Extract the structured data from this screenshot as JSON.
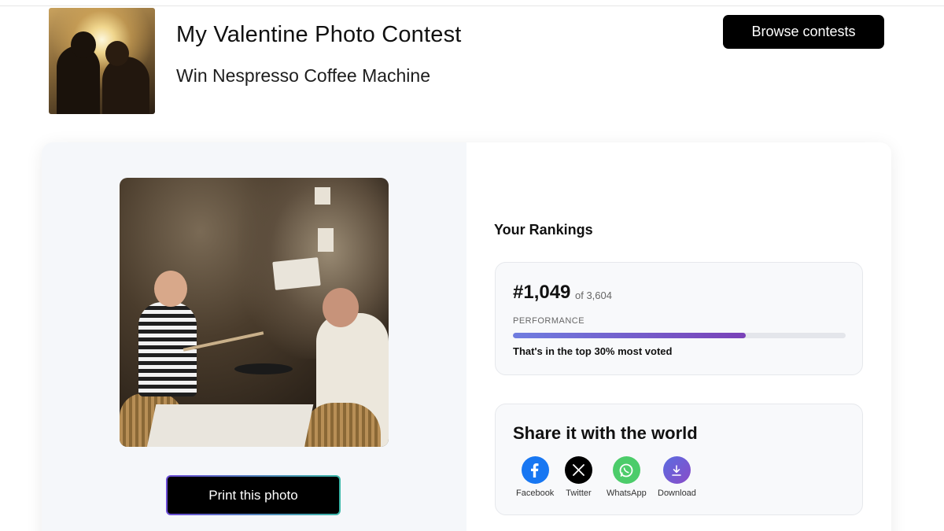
{
  "header": {
    "title": "My Valentine Photo Contest",
    "subtitle": "Win Nespresso Coffee Machine",
    "browse_label": "Browse contests"
  },
  "entry": {
    "print_label": "Print this photo"
  },
  "rankings": {
    "heading": "Your Rankings",
    "rank": "#1,049",
    "total": "of 3,604",
    "performance_label": "PERFORMANCE",
    "performance_fraction": 0.7,
    "note": "That's in the top 30% most voted"
  },
  "share": {
    "heading": "Share it with the world",
    "items": [
      {
        "label": "Facebook",
        "icon": "facebook-icon",
        "color": "#1877f2"
      },
      {
        "label": "Twitter",
        "icon": "x-twitter-icon",
        "color": "#000000"
      },
      {
        "label": "WhatsApp",
        "icon": "whatsapp-icon",
        "color": "#4ccc6a"
      },
      {
        "label": "Download",
        "icon": "download-icon",
        "color": "#6b5bd6"
      }
    ]
  },
  "colors": {
    "accent_start": "#6f7de0",
    "accent_end": "#7a42b8"
  }
}
